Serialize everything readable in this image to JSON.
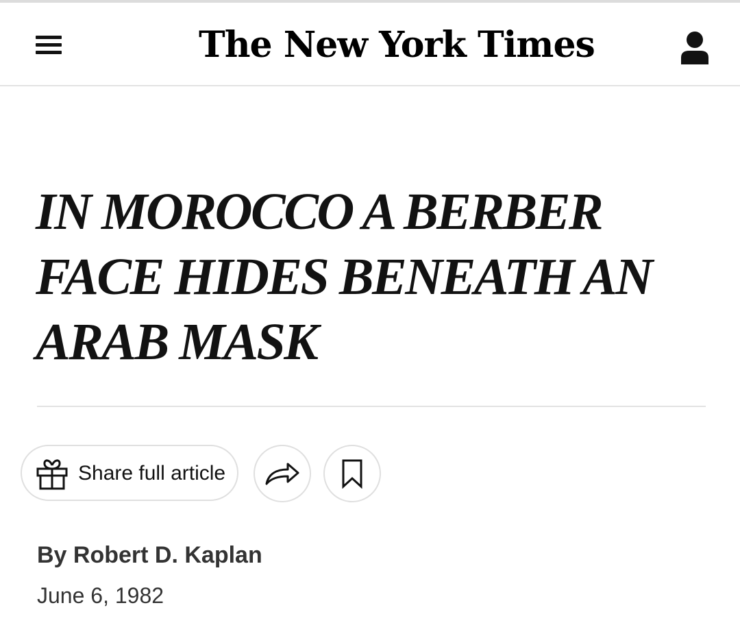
{
  "header": {
    "masthead": "The New York Times",
    "menu_icon": "hamburger-menu-icon",
    "account_icon": "user-account-icon"
  },
  "article": {
    "headline": "IN MOROCCO A BERBER FACE HIDES BENEATH AN ARAB MASK",
    "byline": "By Robert D. Kaplan",
    "date": "June 6, 1982"
  },
  "actions": {
    "share_label": "Share full article",
    "share_icon": "gift-icon",
    "forward_icon": "share-arrow-icon",
    "bookmark_icon": "bookmark-icon"
  },
  "colors": {
    "text": "#121212",
    "byline": "#333333",
    "border": "#dfdfdf"
  }
}
